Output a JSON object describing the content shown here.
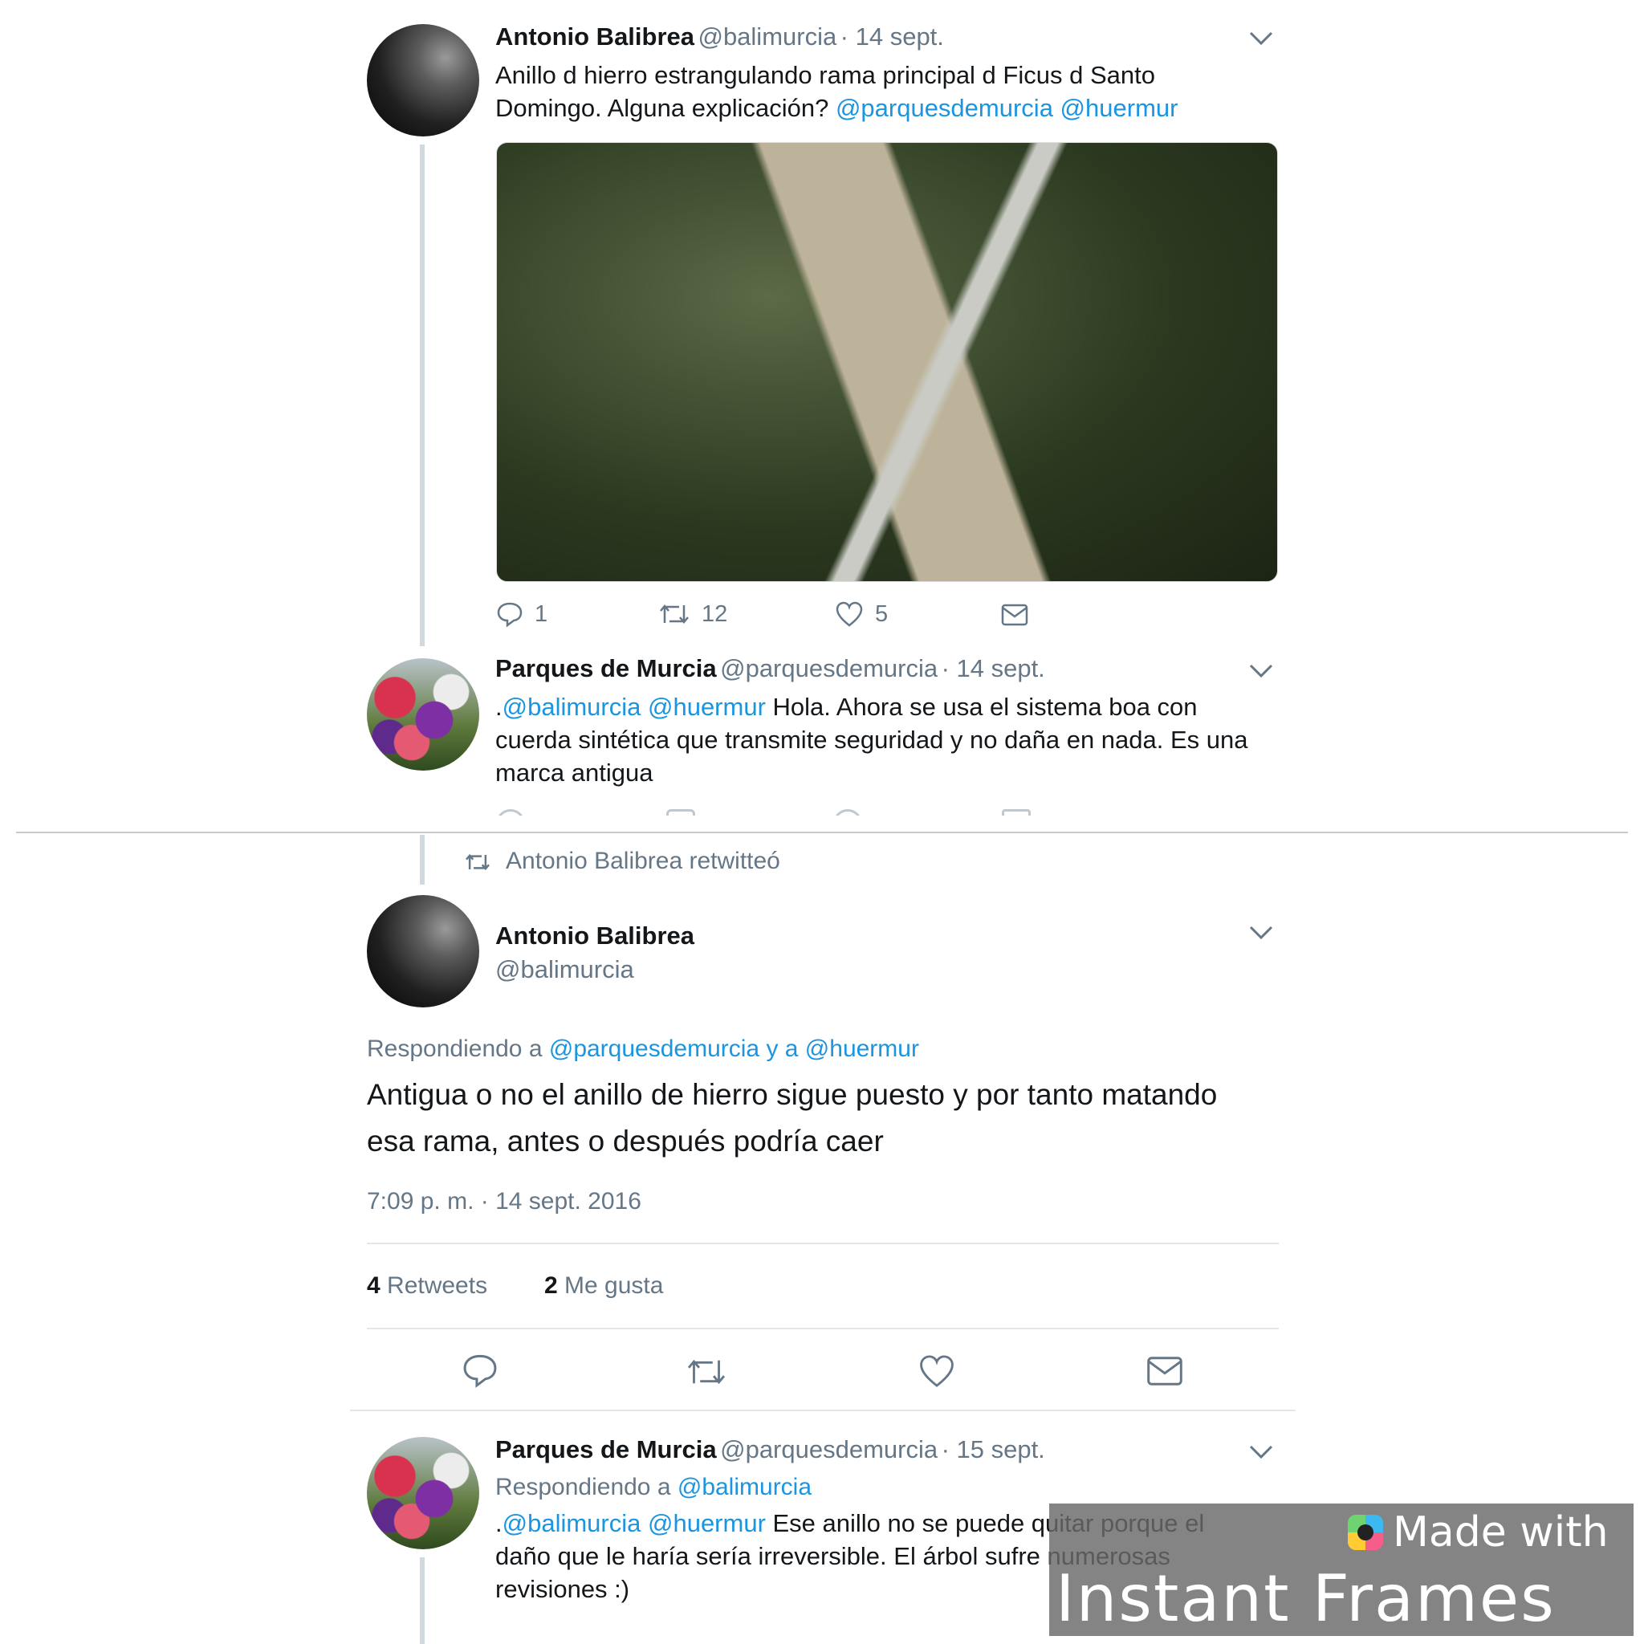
{
  "tweet1": {
    "name": "Antonio Balibrea",
    "handle": "@balimurcia",
    "date": "· 14 sept.",
    "line1": "Anillo d hierro estrangulando rama principal d Ficus d Santo",
    "line2_text": "Domingo. Alguna explicación? ",
    "line2_mention1": "@parquesdemurcia",
    "line2_mention2": " @huermur",
    "reply_count": "1",
    "retweet_count": "12",
    "like_count": "5"
  },
  "tweet2": {
    "name": "Parques de Murcia",
    "handle": "@parquesdemurcia",
    "date": "· 14 sept.",
    "dot": ".",
    "mention1": "@balimurcia",
    "mention2": " @huermur",
    "line1_rest": " Hola. Ahora se usa el sistema boa con",
    "line2": "cuerda sintética que transmite seguridad y no daña en nada. Es una",
    "line3": "marca antigua"
  },
  "retweet_banner": "Antonio Balibrea retwitteó",
  "main": {
    "name": "Antonio Balibrea",
    "handle": "@balimurcia",
    "replying_prefix": "Respondiendo a ",
    "replying_targets": "@parquesdemurcia y a @huermur",
    "line1": "Antigua o no el anillo de hierro sigue puesto y por tanto matando",
    "line2": "esa rama, antes o después podría caer",
    "timestamp": "7:09 p. m. · 14 sept. 2016",
    "retweets_num": "4",
    "retweets_label": " Retweets",
    "likes_num": "2",
    "likes_label": " Me gusta"
  },
  "tweet4": {
    "name": "Parques de Murcia",
    "handle": "@parquesdemurcia",
    "date": "· 15 sept.",
    "replying_prefix": "Respondiendo a ",
    "replying_target": "@balimurcia",
    "dot": ".",
    "mention1": "@balimurcia",
    "mention2": " @huermur",
    "line1_rest": " Ese anillo no se puede quitar porque el",
    "line2": "daño que le haría sería irreversible. El árbol sufre numerosas",
    "line3": "revisiones :)"
  },
  "watermark": {
    "top": "Made with",
    "bottom": "Instant Frames"
  },
  "colors": {
    "link": "#1b95e0",
    "muted": "#657786",
    "text": "#14171a"
  }
}
